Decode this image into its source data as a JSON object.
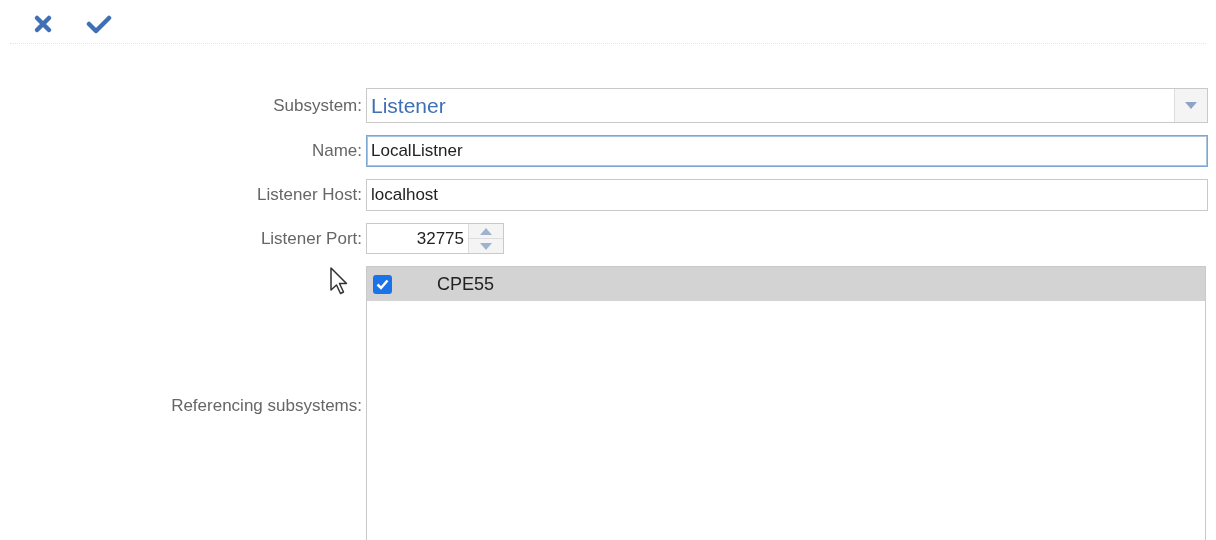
{
  "toolbar": {
    "buttons": [
      {
        "kind": "cancel"
      },
      {
        "kind": "confirm"
      }
    ]
  },
  "form": {
    "fields": [
      {
        "kind": "select",
        "label": "Subsystem:",
        "value": "Listener",
        "focused": false
      },
      {
        "kind": "text",
        "label": "Name:",
        "value": "LocalListner",
        "focused": true
      },
      {
        "kind": "text",
        "label": "Listener Host:",
        "value": "localhost",
        "focused": false
      },
      {
        "kind": "spinner",
        "label": "Listener Port:",
        "value": "32775",
        "focused": false
      },
      {
        "kind": "list",
        "label": "Referencing subsystems:",
        "items": [
          {
            "label": "CPE55",
            "checked": true,
            "selected": true
          }
        ]
      }
    ]
  }
}
